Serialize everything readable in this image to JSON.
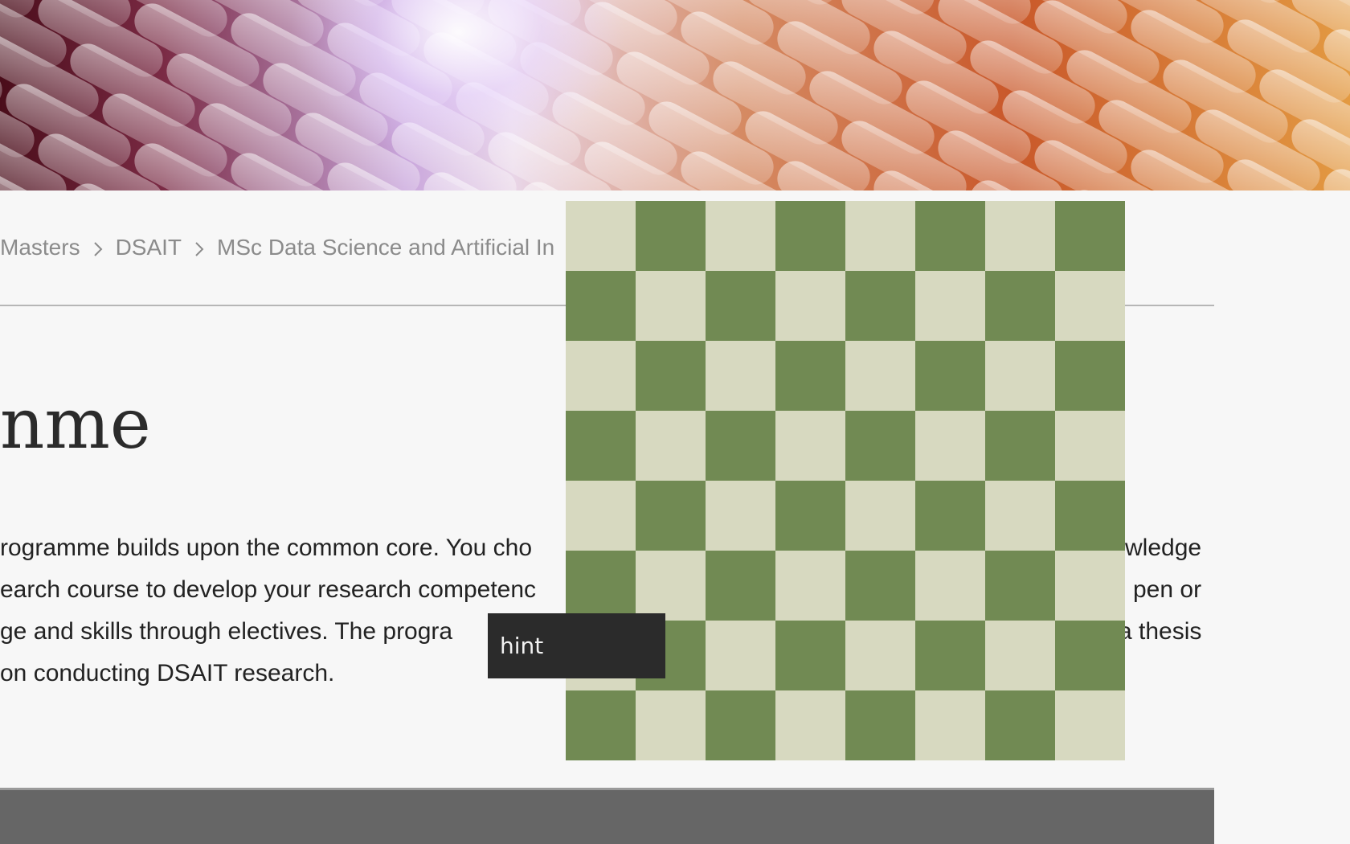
{
  "breadcrumb": {
    "items": [
      {
        "label": "Masters"
      },
      {
        "label": "DSAIT"
      },
      {
        "label": "MSc Data Science and Artificial In"
      }
    ]
  },
  "page": {
    "title": "nme"
  },
  "body": {
    "lines": [
      "rogramme builds upon the common core. You cho",
      "earch course to develop your research competenc",
      "ge and skills through electives. The progra",
      "on conducting DSAIT research."
    ],
    "right_fragments": [
      "wledge",
      "pen or",
      "a thesis"
    ]
  },
  "board": {
    "rows": 8,
    "cols": 8,
    "light_color": "#d7d9c0",
    "dark_color": "#718a53"
  },
  "hint": {
    "label": "hint"
  }
}
